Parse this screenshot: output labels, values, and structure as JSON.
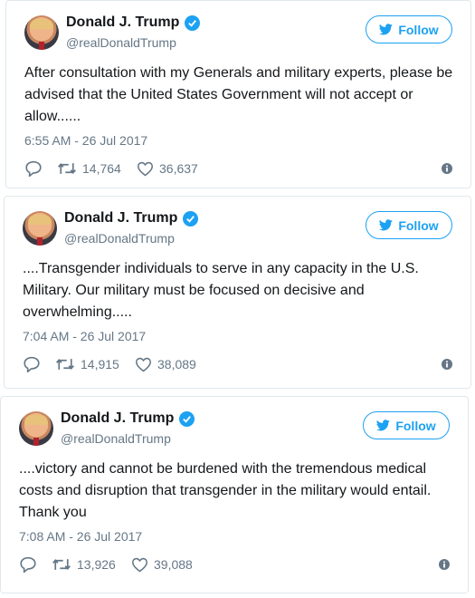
{
  "tweets": [
    {
      "name": "Donald J. Trump",
      "handle": "@realDonaldTrump",
      "follow_label": "Follow",
      "text": "After consultation with my Generals and military experts, please be advised that the United States Government will not accept or allow......",
      "timestamp": "6:55 AM - 26 Jul 2017",
      "retweets": "14,764",
      "likes": "36,637"
    },
    {
      "name": "Donald J. Trump",
      "handle": "@realDonaldTrump",
      "follow_label": "Follow",
      "text": "....Transgender individuals to serve in any capacity in the U.S. Military. Our military must be focused on decisive and overwhelming.....",
      "timestamp": "7:04 AM - 26 Jul 2017",
      "retweets": "14,915",
      "likes": "38,089"
    },
    {
      "name": "Donald J. Trump",
      "handle": "@realDonaldTrump",
      "follow_label": "Follow",
      "text": "....victory and cannot be burdened with the tremendous medical costs and disruption that transgender in the military would entail. Thank you",
      "timestamp": "7:08 AM - 26 Jul 2017",
      "retweets": "13,926",
      "likes": "39,088"
    }
  ],
  "icons": {
    "verified": "verified-badge-icon",
    "follow": "twitter-bird-icon",
    "reply": "reply-icon",
    "retweet": "retweet-icon",
    "like": "heart-icon",
    "info": "info-icon"
  },
  "colors": {
    "accent": "#1da1f2",
    "muted": "#657786",
    "text": "#14171a",
    "border": "#e1e8ed"
  }
}
